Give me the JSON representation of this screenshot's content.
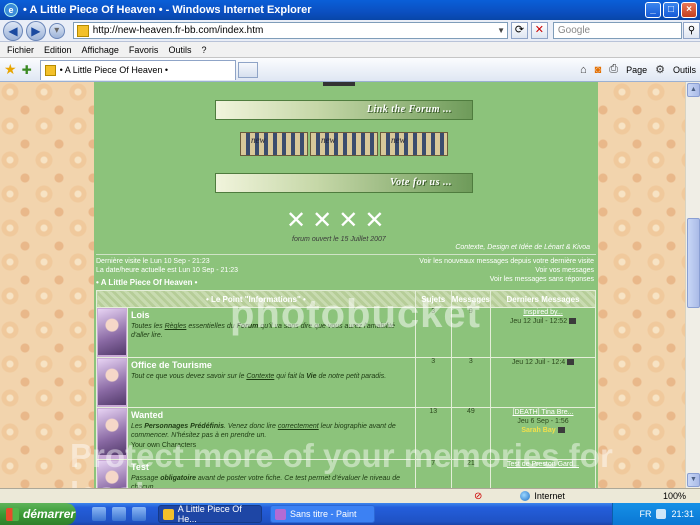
{
  "window": {
    "title": "• A Little Piece Of Heaven • - Windows Internet Explorer",
    "min": "_",
    "max": "□",
    "close": "×"
  },
  "address": {
    "url": "http://new-heaven.fr-bb.com/index.htm",
    "search_placeholder": "Google"
  },
  "menu": [
    "Fichier",
    "Edition",
    "Affichage",
    "Favoris",
    "Outils",
    "?"
  ],
  "tab": {
    "label": "• A Little Piece Of Heaven •"
  },
  "commands": {
    "page": "Page",
    "tools": "Outils"
  },
  "forum": {
    "banner_link": "Link the Forum ...",
    "banner_vote": "Vote for us ...",
    "thumb_text": "new",
    "crosses": "✕✕✕✕",
    "founded": "forum ouvert le 15 Juillet 2007",
    "credit": "Contexte, Design et Idée de Lénart & Kivoa",
    "last_visit": "Dernière visite le Lun 10 Sep - 21:23",
    "current_date": "La date/heure actuelle est Lun 10 Sep - 21:23",
    "new_since": "Voir les nouveaux messages depuis votre dernière visite",
    "your_messages": "Voir vos messages",
    "unanswered": "Voir les messages sans réponses",
    "breadcrumb": "• A Little Piece Of Heaven •",
    "table_headers": {
      "forum": "• Le Point \"Informations\" •",
      "topics": "Sujets",
      "posts": "Messages",
      "last": "Derniers Messages"
    },
    "rows": [
      {
        "name": "Lois",
        "text1": "Toutes les ",
        "text_u1": "Règles",
        "text2": " essentielles du ",
        "text_b": "Forum",
        "text3": " qu'il va sans dire que vous aurez l'amabilité d'aller lire.",
        "sub": "",
        "topics": "3",
        "posts": "9",
        "last_title": "Inspired by...",
        "last_date": "Jeu 12 Juil - 12:52",
        "last_user": ""
      },
      {
        "name": "Office de Tourisme",
        "text1": "Tout ce que vous devez savoir sur le ",
        "text_u1": "Contexte",
        "text2": " qui fait la ",
        "text_b": "Vie",
        "text3": " de notre petit paradis.",
        "sub": "",
        "topics": "3",
        "posts": "3",
        "last_title": "",
        "last_date": "Jeu 12 Juil - 12:4",
        "last_user": ""
      },
      {
        "name": "Wanted",
        "text1": "Les ",
        "text_u1": "Personnages Prédéfinis",
        "text2": ". Venez donc lire ",
        "text_b": "correctement",
        "text3": " leur biographie avant de commencer. N'hésitez pas à en prendre un.",
        "sub": "Your own Characters",
        "topics": "13",
        "posts": "49",
        "last_title": "[DEATH] Tina Bre...",
        "last_date": "Jeu 6 Sep - 1:56",
        "last_user": "Sarah Bay"
      },
      {
        "name": "Test",
        "text1": "Passage ",
        "text_u1": "obligatoire",
        "text2": " avant de poster votre fiche. Ce test permet d'évaluer le ",
        "text_b": "niveau",
        "text3": " de chacun.",
        "sub": "",
        "topics": "7",
        "posts": "21",
        "last_title": "Test de Preston Gard...",
        "last_date": "",
        "last_user": ""
      }
    ]
  },
  "watermark": {
    "line1": "photobucket",
    "line2": "Protect more of your memories for less!"
  },
  "status": {
    "zone": "Internet",
    "zoom": "100%"
  },
  "taskbar": {
    "start": "démarrer",
    "task1": "A Little Piece Of He...",
    "task2": "Sans titre - Paint",
    "lang": "FR",
    "clock": "21:31"
  }
}
